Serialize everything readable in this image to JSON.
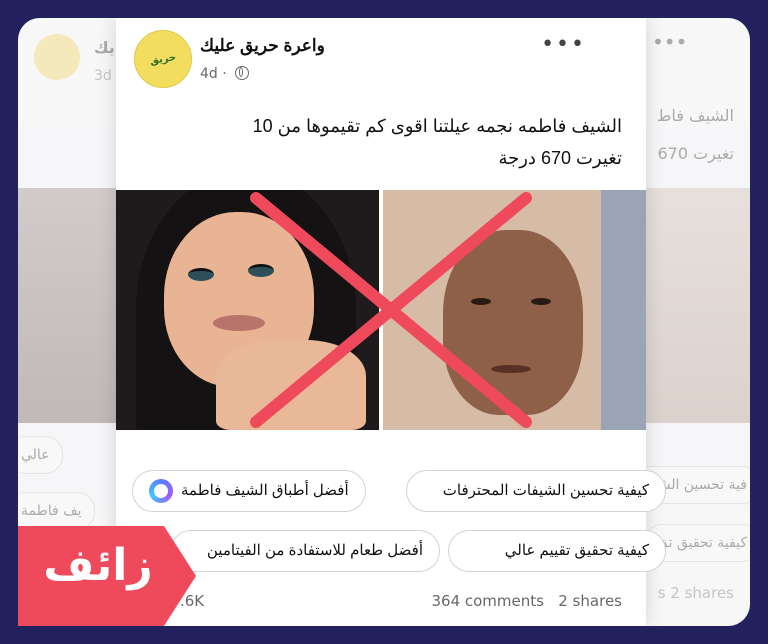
{
  "post": {
    "page_name": "واعرة حريق عليك",
    "time": "4d ·",
    "caption_line1": "الشيف فاطمه نجمه عيلتنا اقوى كم تقيموها من 10",
    "caption_line2": "تغيرت 670 درجة",
    "more_icon": "•••"
  },
  "chips": {
    "chip1": "أفضل أطباق الشيف فاطمة",
    "chip2": "كيفية تحسين الشيفات المحترفات",
    "chip3": "أفضل طعام للاستفادة من الفيتامين",
    "chip4": "كيفية تحقيق تقييم عالي"
  },
  "stats": {
    "likes": ".6K",
    "comments": "364 comments",
    "shares": "2 shares"
  },
  "ghost_left": {
    "page_name_fragment": "يك",
    "time": "3d",
    "chip1": "عالي",
    "chip2": "يف فاطمة"
  },
  "ghost_right": {
    "more_icon": "•••",
    "caption_fragment1": "الشيف فاط",
    "caption_fragment2": "تغيرت 670",
    "chip1": "فية تحسين الشيف",
    "chip2": "كيفية تحقيق تق",
    "shares": "s 2 shares"
  },
  "badge": {
    "label": "زائف",
    "color": "#ef4a5b"
  },
  "icons": {
    "globe": "globe-icon",
    "more": "more-options-icon",
    "ai_ring": "meta-ai-ring-icon"
  },
  "colors": {
    "background": "#24215f",
    "cross": "#ef4a5b",
    "avatar": "#f2dd5e"
  }
}
